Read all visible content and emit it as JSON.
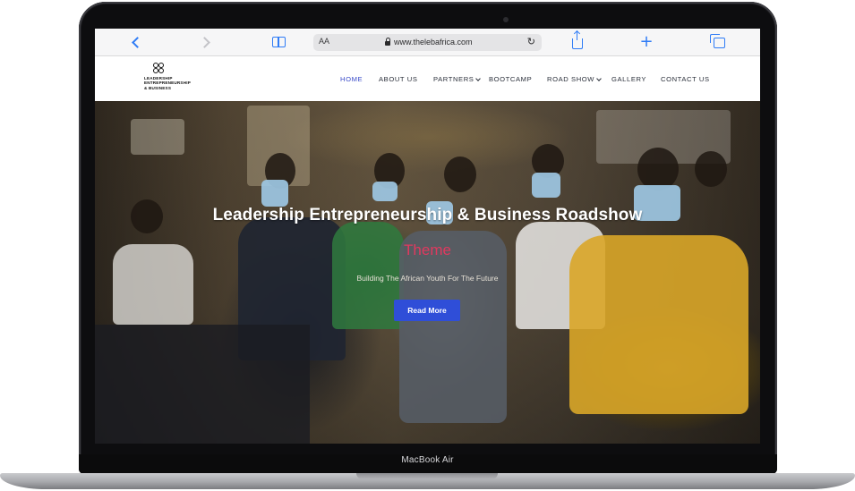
{
  "safari": {
    "text_size_label": "AA",
    "url": "www.thelebafrica.com",
    "icons": [
      "back-icon",
      "forward-icon",
      "bookmarks-icon",
      "reload-icon",
      "share-icon",
      "new-tab-icon",
      "tabs-icon"
    ]
  },
  "site": {
    "logo_lines": [
      "LEADERSHIP",
      "ENTREPRENEURSHIP",
      "& BUSINESS"
    ],
    "menu": [
      {
        "label": "HOME",
        "active": true
      },
      {
        "label": "ABOUT US",
        "active": false
      },
      {
        "label": "PARTNERS",
        "active": false,
        "dropdown": true
      },
      {
        "label": "BOOTCAMP",
        "active": false
      },
      {
        "label": "ROAD SHOW",
        "active": false,
        "dropdown": true
      },
      {
        "label": "GALLERY",
        "active": false
      },
      {
        "label": "CONTACT US",
        "active": false
      }
    ],
    "accent_color": "#3a4bc9"
  },
  "hero": {
    "title": "Leadership Entrepreneurship & Business Roadshow",
    "theme": "Theme",
    "subtitle": "Building The African Youth For The Future",
    "button_label": "Read More",
    "button_color": "#2f4ed8",
    "theme_color": "#e0395f"
  },
  "device": {
    "model_label": "MacBook Air"
  }
}
